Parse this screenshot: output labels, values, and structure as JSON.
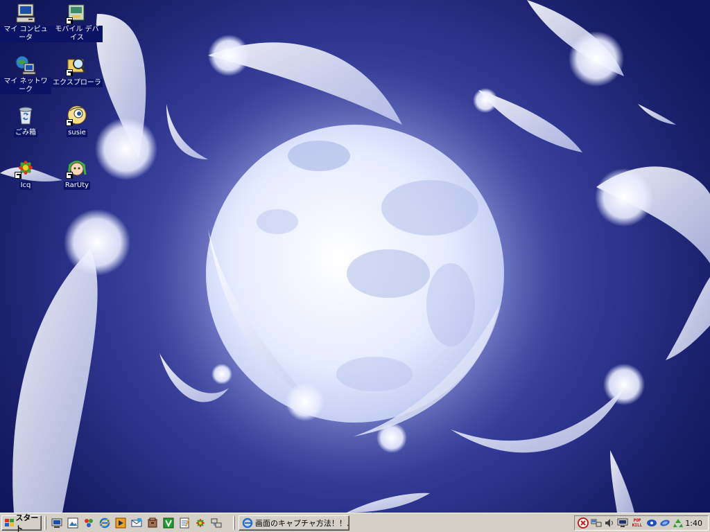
{
  "desktop": {
    "icons": [
      {
        "label": "マイ コンピュータ",
        "icon": "my-computer-icon"
      },
      {
        "label": "モバイル デバイス",
        "icon": "mobile-devices-icon"
      },
      {
        "label": "マイ ネットワーク",
        "icon": "my-network-icon"
      },
      {
        "label": "エクスプローラ",
        "icon": "explorer-icon"
      },
      {
        "label": "ごみ箱",
        "icon": "recycle-bin-icon"
      },
      {
        "label": "susie",
        "icon": "susie-icon"
      },
      {
        "label": "Icq",
        "icon": "icq-icon"
      },
      {
        "label": "RarUty",
        "icon": "rarutil-icon"
      }
    ]
  },
  "taskbar": {
    "start_label": "スタート",
    "quick_launch": [
      "show-desktop-icon",
      "image-tool-icon",
      "paint-icon",
      "internet-explorer-icon",
      "media-player-icon",
      "outlook-express-icon",
      "archive-icon",
      "vector-icon",
      "notepad-icon",
      "icq-icon",
      "network-tool-icon"
    ],
    "task_button_label": "画面のキャプチャ方法！！...",
    "tray_icons": [
      "antivirus-icon",
      "network-status-icon",
      "volume-icon",
      "monitor-icon",
      "popkill-icon",
      "chat-icon",
      "messenger-icon",
      "recycle-icon"
    ],
    "popkill_text": "POP KILL",
    "clock": "1:40"
  },
  "colors": {
    "desktop_bg": "#2f3690",
    "taskbar": "#d4d0c8",
    "icon_label_bg": "#0b1366"
  }
}
